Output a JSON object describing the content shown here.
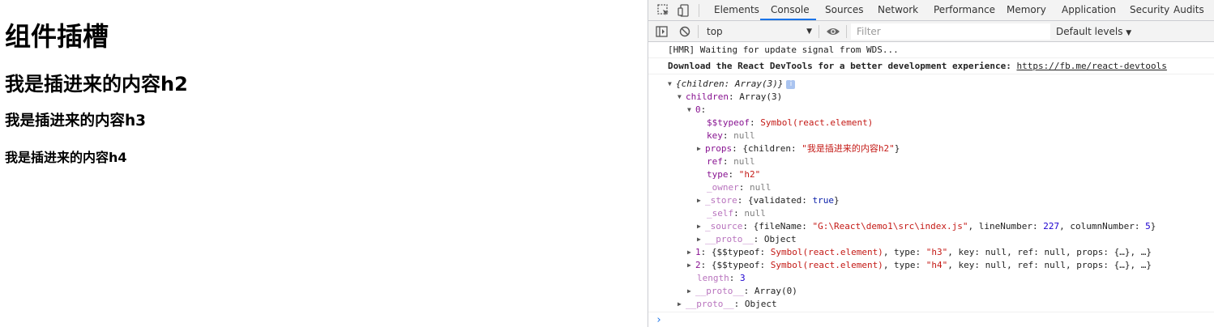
{
  "page": {
    "h1": "组件插槽",
    "h2": "我是插进来的内容h2",
    "h3": "我是插进来的内容h3",
    "h4": "我是插进来的内容h4"
  },
  "devtools": {
    "tabs": [
      "Elements",
      "Console",
      "Sources",
      "Network",
      "Performance",
      "Memory",
      "Application",
      "Security",
      "Audits"
    ],
    "active_tab": "Console",
    "toolbar": {
      "context": "top",
      "filter_placeholder": "Filter",
      "levels": "Default levels"
    },
    "messages": [
      {
        "text": "[HMR] Waiting for update signal from WDS..."
      },
      {
        "text": "Download the React DevTools for a better development experience: ",
        "link": "https://fb.me/react-devtools"
      }
    ],
    "tree": {
      "root": "{children: Array(3)}",
      "children_key": "children",
      "children_val": "Array(3)",
      "item0_key": "0",
      "typeof_key": "$$typeof",
      "typeof_val": "Symbol(react.element)",
      "key_key": "key",
      "null": "null",
      "props_key": "props",
      "props_val_prefix": "{children: ",
      "props_val_str": "\"我是插进来的内容h2\"",
      "props_val_suffix": "}",
      "ref_key": "ref",
      "type_key": "type",
      "type_val": "\"h2\"",
      "owner_key": "_owner",
      "store_key": "_store",
      "store_prefix": "{validated: ",
      "store_bool": "true",
      "store_suffix": "}",
      "self_key": "_self",
      "source_key": "_source",
      "source_p1": "{fileName: ",
      "source_file": "\"G:\\React\\demo1\\src\\index.js\"",
      "source_p2": ", lineNumber: ",
      "source_line": "227",
      "source_p3": ", columnNumber: ",
      "source_col": "5",
      "source_p4": "}",
      "proto_key": "__proto__",
      "object": "Object",
      "item1_key": "1",
      "item2_key": "2",
      "item_p1": "{$$typeof: ",
      "item_sym": "Symbol(react.element)",
      "item_p2": ", type: ",
      "item1_type": "\"h3\"",
      "item2_type": "\"h4\"",
      "item_p3": ", key: null, ref: null, props: {…}, …}",
      "length_key": "length",
      "length_val": "3",
      "array0": "Array(0)"
    },
    "prompt_caret": "›"
  }
}
